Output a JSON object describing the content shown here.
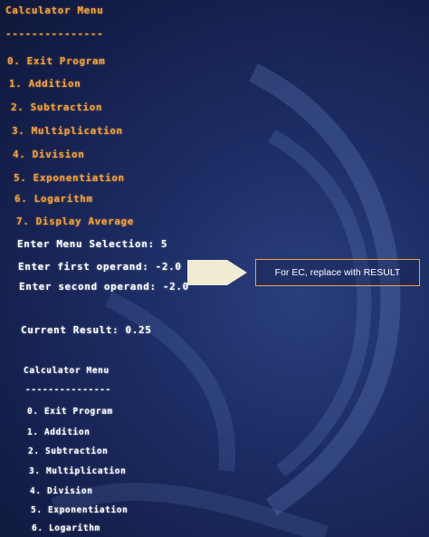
{
  "menu1": {
    "title": "Calculator Menu",
    "divider": "---------------",
    "items": [
      "0. Exit Program",
      "1. Addition",
      "2. Subtraction",
      "3. Multiplication",
      "4. Division",
      "5. Exponentiation",
      "6. Logarithm",
      "7. Display Average"
    ]
  },
  "session": {
    "selection_line": "Enter Menu Selection: 5",
    "first_operand_line": "Enter first operand: -2.0",
    "second_operand_line": "Enter second operand: -2.0",
    "current_result_line": "Current Result: 0.25"
  },
  "annotation": {
    "note": "For EC, replace with RESULT",
    "arrow_color": "#fdf6d8",
    "border_color": "#f0a23c"
  },
  "menu2": {
    "title": "Calculator Menu",
    "divider": "---------------",
    "items": [
      "0. Exit Program",
      "1. Addition",
      "2. Subtraction",
      "3. Multiplication",
      "4. Division",
      "5. Exponentiation",
      "6. Logarithm"
    ]
  },
  "colors": {
    "background": "#1c2c63",
    "menu_text": "#f0a23c",
    "prompt_text": "#ffffff"
  }
}
